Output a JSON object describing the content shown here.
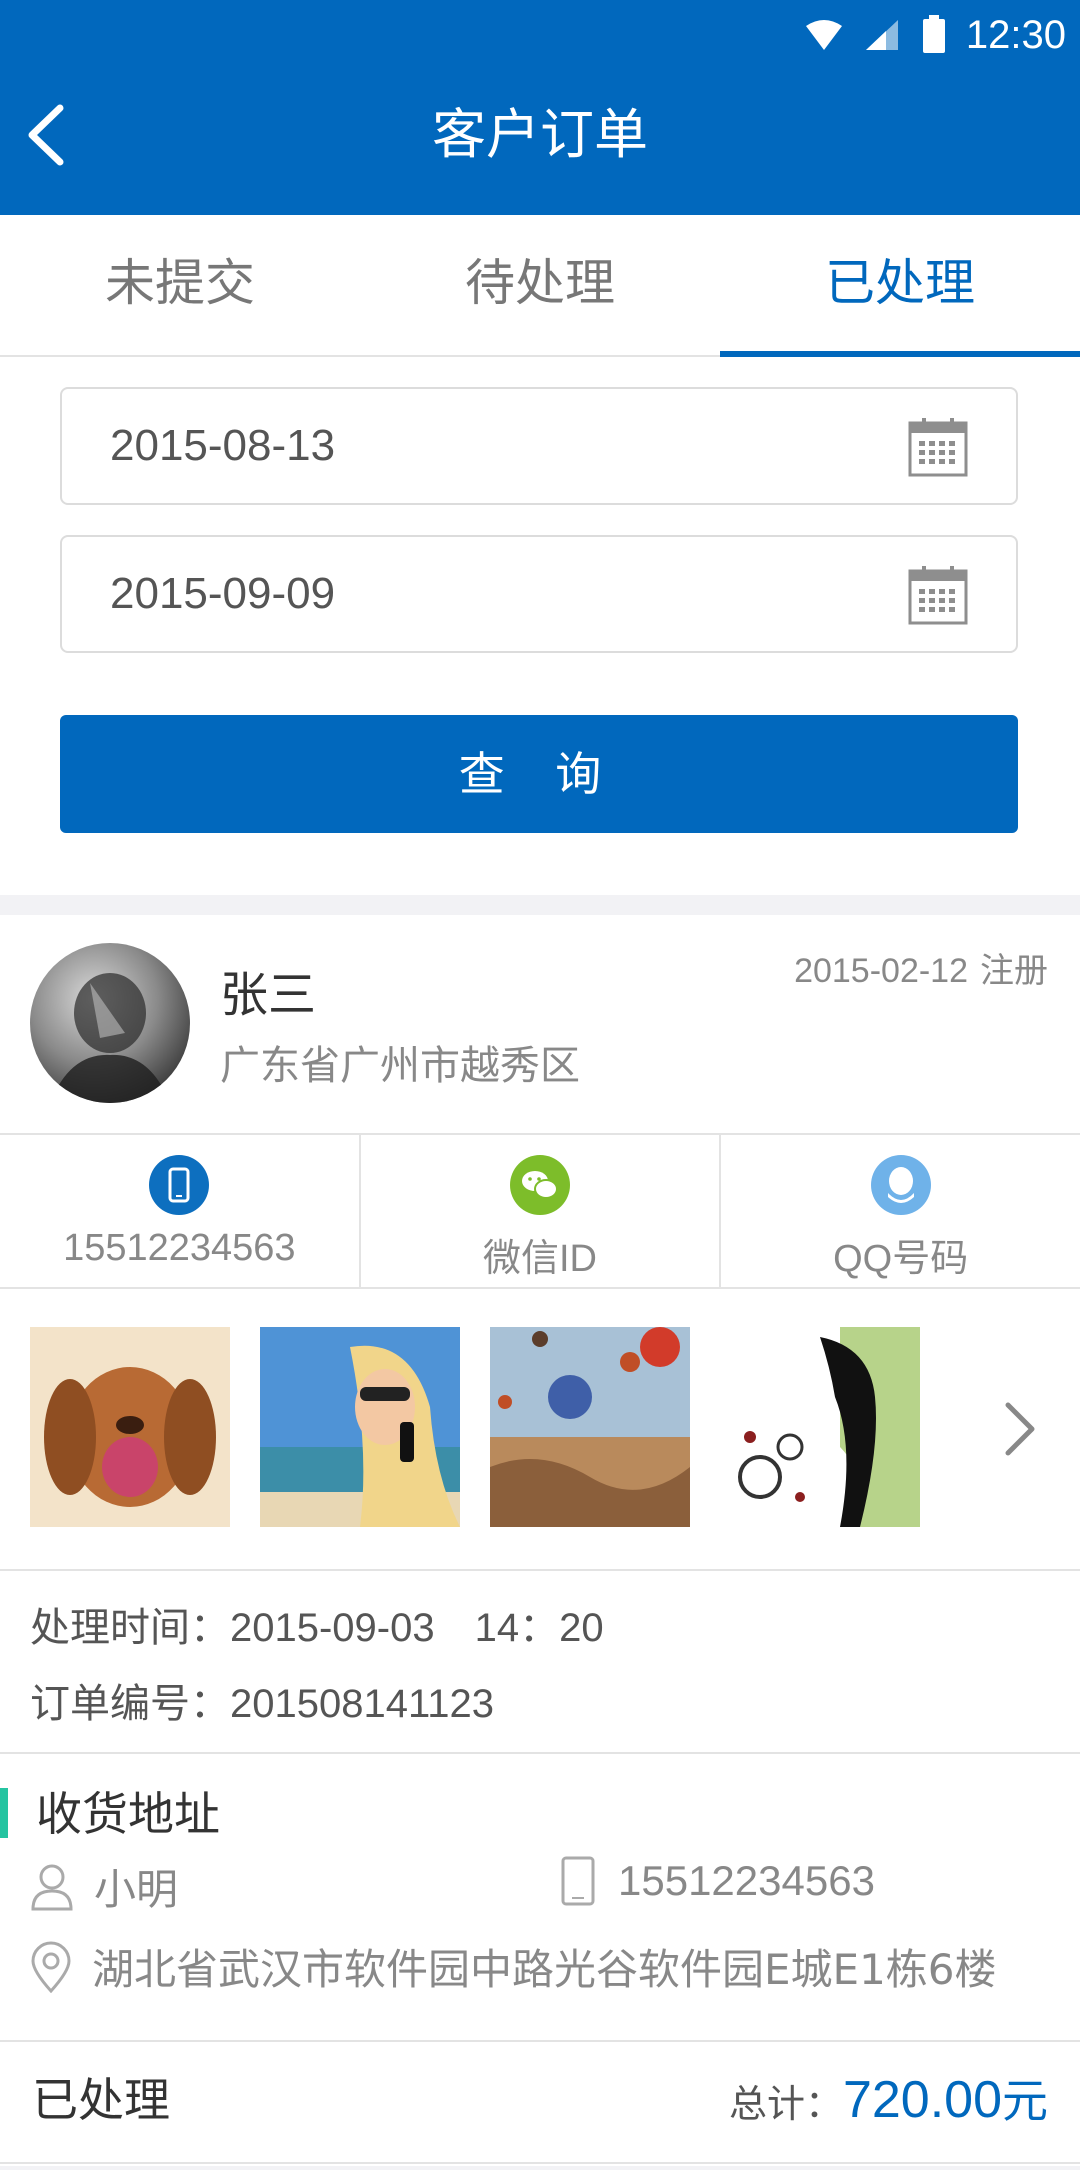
{
  "status_bar": {
    "time": "12:30",
    "icons": [
      "wifi-icon",
      "signal-icon",
      "battery-icon"
    ]
  },
  "header": {
    "title": "客户订单",
    "back_icon": "chevron-left-icon"
  },
  "tabs": [
    {
      "label": "未提交"
    },
    {
      "label": "待处理"
    },
    {
      "label": "已处理"
    }
  ],
  "active_tab": "已处理",
  "query": {
    "start_date": "2015-08-13",
    "end_date": "2015-09-09",
    "button_label": "查 询",
    "date_icon": "calendar-icon"
  },
  "customer": {
    "name": "张三",
    "region": "广东省广州市越秀区",
    "reg_date": "2015-02-12",
    "reg_label": "注册"
  },
  "contacts": [
    {
      "label": "15512234563",
      "icon": "phone-icon",
      "color": "#0d6fbf"
    },
    {
      "label": "微信ID",
      "icon": "wechat-icon",
      "color": "#7dbd2a"
    },
    {
      "label": "QQ号码",
      "icon": "qq-icon",
      "color": "#6fb2e9"
    }
  ],
  "photos": [
    "dog-photo",
    "woman-phone-photo",
    "balloons-photo",
    "floral-silhouette-photo"
  ],
  "order": {
    "time_label": "处理时间：",
    "time_value": "2015-09-03　14：20",
    "number_label": "订单编号：",
    "number_value": "201508141123"
  },
  "address": {
    "heading": "收货地址",
    "recipient": "小明",
    "phone": "15512234563",
    "full": "湖北省武汉市软件园中路光谷软件园E城E1栋6楼"
  },
  "footer": {
    "status": "已处理",
    "total_label": "总计：",
    "total_amount": "720.00",
    "currency": "元"
  },
  "colors": {
    "primary": "#0168bd",
    "accent_bar": "#25c4a1"
  }
}
